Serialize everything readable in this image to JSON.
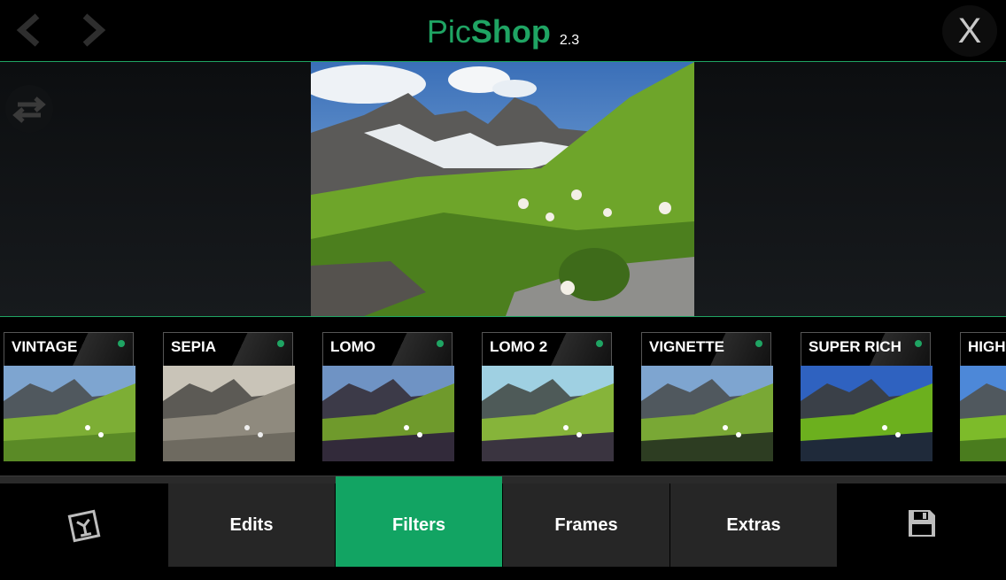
{
  "header": {
    "title_light": "Pic",
    "title_bold": "Shop",
    "version": "2.3",
    "back_icon": "chevron-left-icon",
    "forward_icon": "chevron-right-icon",
    "close_label": "X"
  },
  "preview": {
    "swap_icon": "swap-arrows-icon"
  },
  "filters": [
    {
      "label": "VINTAGE"
    },
    {
      "label": "SEPIA"
    },
    {
      "label": "LOMO"
    },
    {
      "label": "LOMO 2"
    },
    {
      "label": "VIGNETTE"
    },
    {
      "label": "SUPER RICH"
    },
    {
      "label": "HIGH"
    }
  ],
  "tabs": {
    "gallery_icon": "photo-gallery-icon",
    "edits": "Edits",
    "filters": "Filters",
    "frames": "Frames",
    "extras": "Extras",
    "save_icon": "floppy-disk-icon"
  },
  "colors": {
    "accent": "#1fa463",
    "tab_active": "#12a463",
    "tab_bg": "#262626"
  }
}
